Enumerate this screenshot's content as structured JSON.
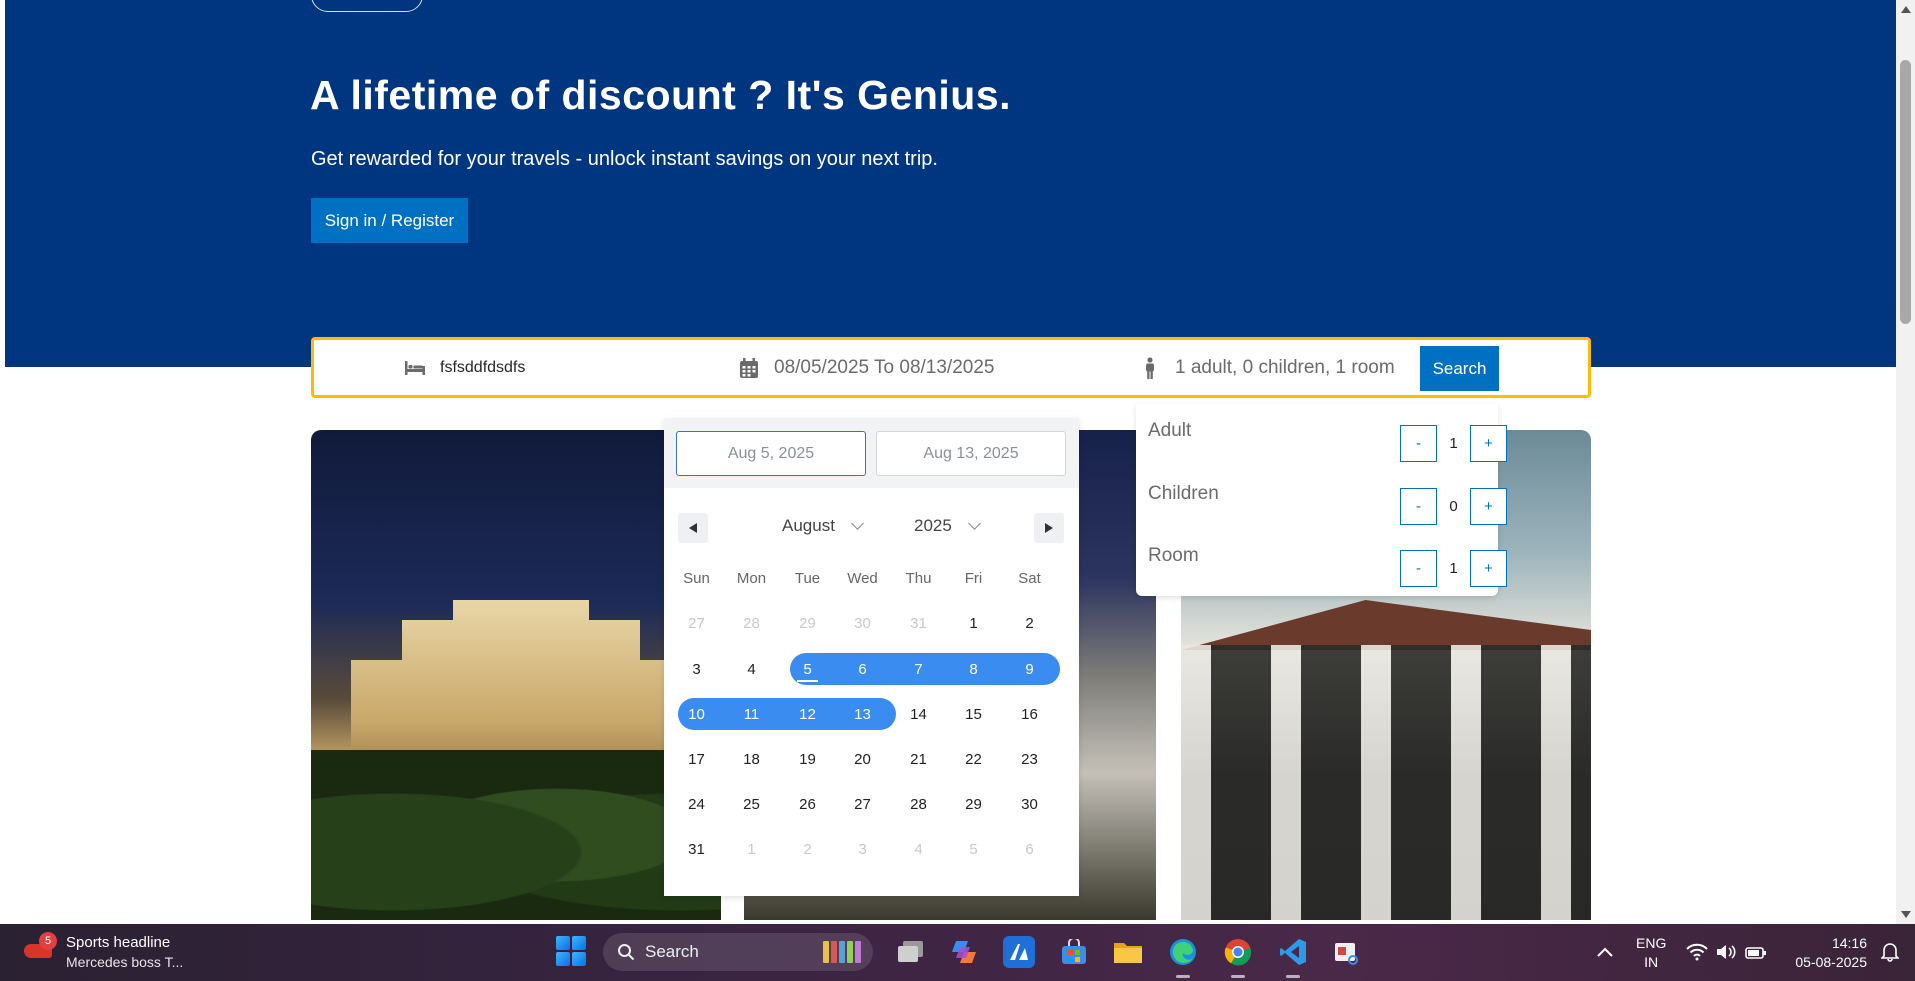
{
  "hero": {
    "title": "A lifetime of discount ? It's Genius.",
    "subtitle": "Get rewarded for your travels - unlock instant savings on your next trip.",
    "signin_label": "Sign in / Register",
    "bg_color": "#003580"
  },
  "search": {
    "destination": "fsfsddfdsdfs",
    "dates": "08/05/2025 To 08/13/2025",
    "guests": "1 adult, 0 children, 1 room",
    "button_label": "Search"
  },
  "datepicker": {
    "start_input": "Aug 5, 2025",
    "end_input": "Aug 13, 2025",
    "month": "August",
    "year": "2025",
    "weekdays": [
      "Sun",
      "Mon",
      "Tue",
      "Wed",
      "Thu",
      "Fri",
      "Sat"
    ],
    "weeks": [
      [
        [
          "27",
          "muted"
        ],
        [
          "28",
          "muted"
        ],
        [
          "29",
          "muted"
        ],
        [
          "30",
          "muted"
        ],
        [
          "31",
          "muted"
        ],
        [
          "1",
          ""
        ],
        [
          "2",
          ""
        ]
      ],
      [
        [
          "3",
          ""
        ],
        [
          "4",
          ""
        ],
        [
          "5",
          "sel today"
        ],
        [
          "6",
          "sel"
        ],
        [
          "7",
          "sel"
        ],
        [
          "8",
          "sel"
        ],
        [
          "9",
          "sel"
        ]
      ],
      [
        [
          "10",
          "sel"
        ],
        [
          "11",
          "sel"
        ],
        [
          "12",
          "sel"
        ],
        [
          "13",
          "sel"
        ],
        [
          "14",
          ""
        ],
        [
          "15",
          ""
        ],
        [
          "16",
          ""
        ]
      ],
      [
        [
          "17",
          ""
        ],
        [
          "18",
          ""
        ],
        [
          "19",
          ""
        ],
        [
          "20",
          ""
        ],
        [
          "21",
          ""
        ],
        [
          "22",
          ""
        ],
        [
          "23",
          ""
        ]
      ],
      [
        [
          "24",
          ""
        ],
        [
          "25",
          ""
        ],
        [
          "26",
          ""
        ],
        [
          "27",
          ""
        ],
        [
          "28",
          ""
        ],
        [
          "29",
          ""
        ],
        [
          "30",
          ""
        ]
      ],
      [
        [
          "31",
          ""
        ],
        [
          "1",
          "muted"
        ],
        [
          "2",
          "muted"
        ],
        [
          "3",
          "muted"
        ],
        [
          "4",
          "muted"
        ],
        [
          "5",
          "muted"
        ],
        [
          "6",
          "muted"
        ]
      ]
    ],
    "range_color": "#3b8cf0"
  },
  "guests_popover": {
    "rows": [
      {
        "label": "Adult",
        "value": "1",
        "minus": "-",
        "plus": "+"
      },
      {
        "label": "Children",
        "value": "0",
        "minus": "-",
        "plus": "+"
      },
      {
        "label": "Room",
        "value": "1",
        "minus": "-",
        "plus": "+"
      }
    ]
  },
  "taskbar": {
    "news_badge": "5",
    "news_title": "Sports headline",
    "news_sub": "Mercedes boss T...",
    "search_label": "Search",
    "lang_line1": "ENG",
    "lang_line2": "IN",
    "time": "14:16",
    "date": "05-08-2025"
  }
}
